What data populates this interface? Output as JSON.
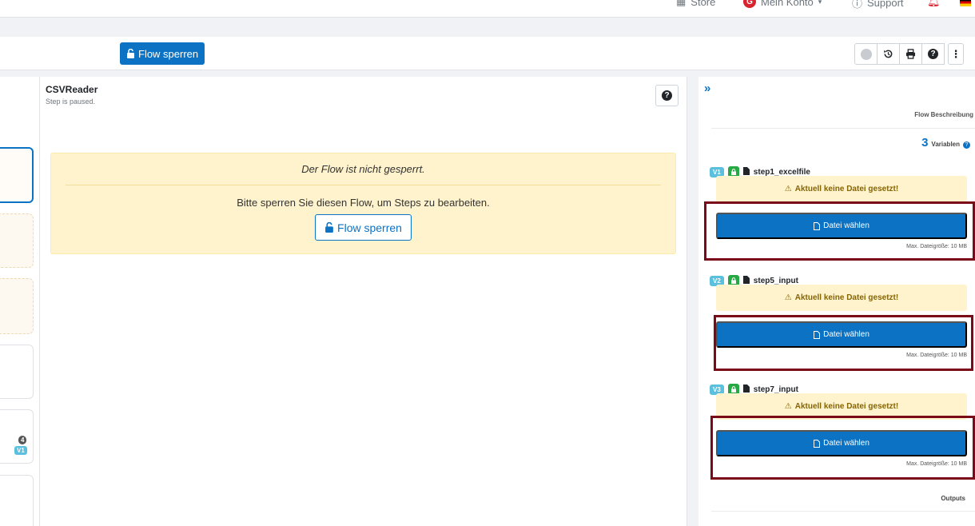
{
  "topnav": {
    "store": "Store",
    "account": "Mein Konto",
    "account_initial": "G",
    "support": "Support"
  },
  "toolbar": {
    "lock_label": "Flow sperren"
  },
  "step": {
    "title": "CSVReader",
    "status": "Step is paused."
  },
  "left_list": {
    "count_badge": "4",
    "version_badge": "V1"
  },
  "alert": {
    "title": "Der Flow ist nicht gesperrt.",
    "text": "Bitte sperren Sie diesen Flow, um Steps zu bearbeiten.",
    "button": "Flow sperren"
  },
  "sidebar": {
    "flow_description": "Flow Beschreibung",
    "variables_count": "3",
    "variables_label": "Variablen",
    "variables": [
      {
        "badge": "V1",
        "name": "step1_excelfile",
        "warning": "Aktuell keine Datei gesetzt!",
        "button": "Datei wählen",
        "max_size": "Max. Dateigröße: 10 MB"
      },
      {
        "badge": "V2",
        "name": "step5_input",
        "warning": "Aktuell keine Datei gesetzt!",
        "button": "Datei wählen",
        "max_size": "Max. Dateigröße: 10 MB"
      },
      {
        "badge": "V3",
        "name": "step7_input",
        "warning": "Aktuell keine Datei gesetzt!",
        "button": "Datei wählen",
        "max_size": "Max. Dateigröße: 10 MB"
      }
    ],
    "outputs": "Outputs"
  },
  "colors": {
    "primary": "#0b72c4",
    "alert_bg": "#fff3cd",
    "highlight_frame": "#7b0a19",
    "lock_green": "#28a745",
    "version_badge": "#5bc0de"
  }
}
